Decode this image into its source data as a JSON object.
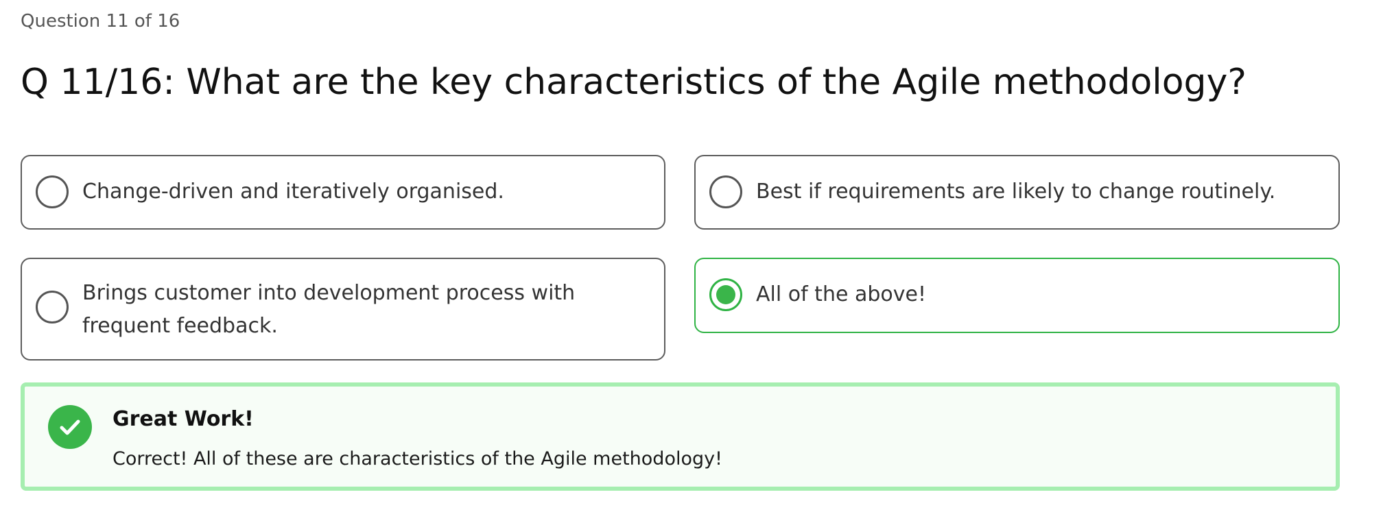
{
  "quiz": {
    "progress_text": "Question 11 of 16",
    "question_title": "Q 11/16: What are the key characteristics of the Agile methodology?"
  },
  "options": [
    {
      "label": "Change-driven and iteratively organised.",
      "selected": false
    },
    {
      "label": "Best if requirements are likely to change routinely.",
      "selected": false
    },
    {
      "label": "Brings customer into development process with frequent feedback.",
      "selected": false
    },
    {
      "label": "All of the above!",
      "selected": true
    }
  ],
  "feedback": {
    "icon": "check-circle-icon",
    "title": "Great Work!",
    "message": "Correct! All of these are characteristics of the Agile methodology!"
  },
  "colors": {
    "accent_green": "#3ab54a",
    "selected_border": "#2fb344",
    "feedback_border": "#a6eeb0",
    "feedback_background": "#f7fdf7"
  }
}
